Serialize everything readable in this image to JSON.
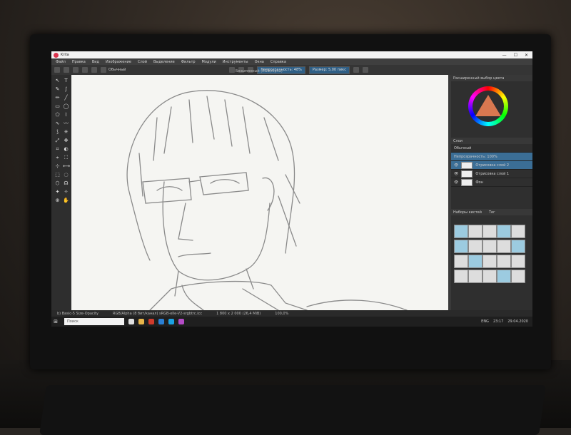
{
  "app": {
    "title": "Krita",
    "window_buttons": [
      "—",
      "☐",
      "✕"
    ]
  },
  "menu": [
    "Файл",
    "Правка",
    "Вид",
    "Изображение",
    "Слой",
    "Выделение",
    "Фильтр",
    "Модули",
    "Инструменты",
    "Окна",
    "Справка"
  ],
  "toolbar": {
    "preset_label": "Обычный",
    "blend_field": "Непрозрачность: 48%",
    "size_field": "Размер: 5,00 пикс"
  },
  "document": {
    "tab_title": "Безымянный (RGB/Alpha)"
  },
  "dock": {
    "color_title": "Расширенный выбор цвета",
    "layers_title": "Слои",
    "blend_mode": "Обычный",
    "opacity_label": "Непрозрачность: 100%",
    "layers": [
      {
        "name": "Отрисовка слой 2",
        "selected": true
      },
      {
        "name": "Отрисовка слой 1",
        "selected": false
      },
      {
        "name": "Фон",
        "selected": false
      }
    ],
    "brush_presets_title": "Наборы кистей",
    "brush_filter": "Тег"
  },
  "status": {
    "left": "b) Basic-5 Size-Opacity",
    "middle": "RGB/Alpha (8 бит/канал) sRGB-elle-V2-srgbtrc.icc",
    "right": "1 800 x 2 000 (26,4 MiB)",
    "zoom": "100,0%"
  },
  "taskbar": {
    "search_placeholder": "Поиск",
    "language": "ENG",
    "time": "23:17",
    "date": "29.04.2020"
  },
  "colors": {
    "accent": "#3b6e96",
    "canvas": "#f5f5f2"
  }
}
